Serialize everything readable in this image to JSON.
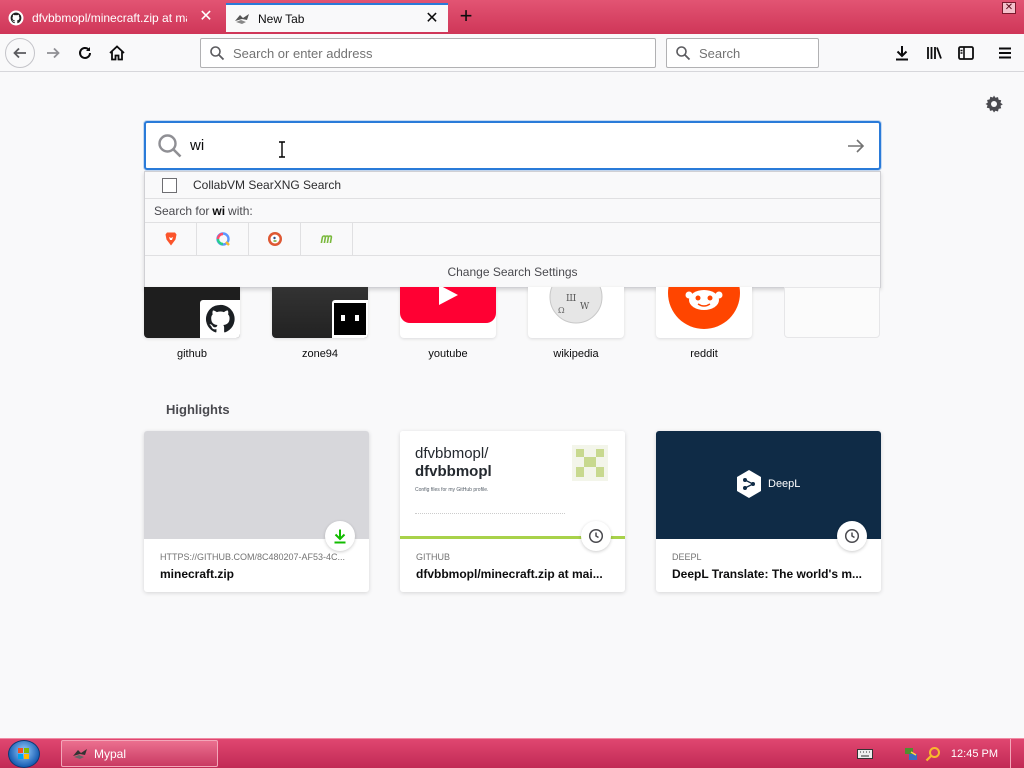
{
  "tabs": [
    {
      "label": "dfvbbmopl/minecraft.zip at mai",
      "active": false,
      "icon": "github-icon"
    },
    {
      "label": "New Tab",
      "active": true,
      "icon": "mypal-icon"
    }
  ],
  "navbar": {
    "url_placeholder": "Search or enter address",
    "search_placeholder": "Search"
  },
  "newtab": {
    "search_query": "wi",
    "dropdown": {
      "suggestion": "CollabVM SearXNG Search",
      "search_for_prefix": "Search for",
      "search_for_term": "wi",
      "search_for_suffix": "with:",
      "engines": [
        "brave-icon",
        "qwant-icon",
        "duckduckgo-icon",
        "mojeek-icon"
      ],
      "settings_label": "Change Search Settings"
    },
    "top_sites": [
      {
        "label": "github",
        "icon": "github-icon"
      },
      {
        "label": "zone94",
        "icon": "zone94-icon"
      },
      {
        "label": "youtube",
        "icon": "youtube-icon"
      },
      {
        "label": "wikipedia",
        "icon": "wikipedia-icon"
      },
      {
        "label": "reddit",
        "icon": "reddit-icon"
      },
      {
        "label": "",
        "icon": ""
      }
    ],
    "highlights_title": "Highlights",
    "highlights": [
      {
        "source": "HTTPS://GITHUB.COM/8C480207-AF53-4C...",
        "title": "minecraft.zip",
        "badge": "download-icon"
      },
      {
        "source": "GITHUB",
        "title": "dfvbbmopl/minecraft.zip at mai...",
        "badge": "clock-icon",
        "preview_title_1": "dfvbbmopl/",
        "preview_title_2": "dfvbbmopl",
        "preview_desc": "Config files for my GitHub profile."
      },
      {
        "source": "DEEPL",
        "title": "DeepL Translate: The world's m...",
        "badge": "clock-icon",
        "preview_brand": "DeepL"
      }
    ]
  },
  "taskbar": {
    "task_label": "Mypal",
    "clock": "12:45 PM"
  },
  "colors": {
    "accent": "#2a7bd9",
    "tabbar": "#d93b5f",
    "taskbar": "#d63762"
  }
}
